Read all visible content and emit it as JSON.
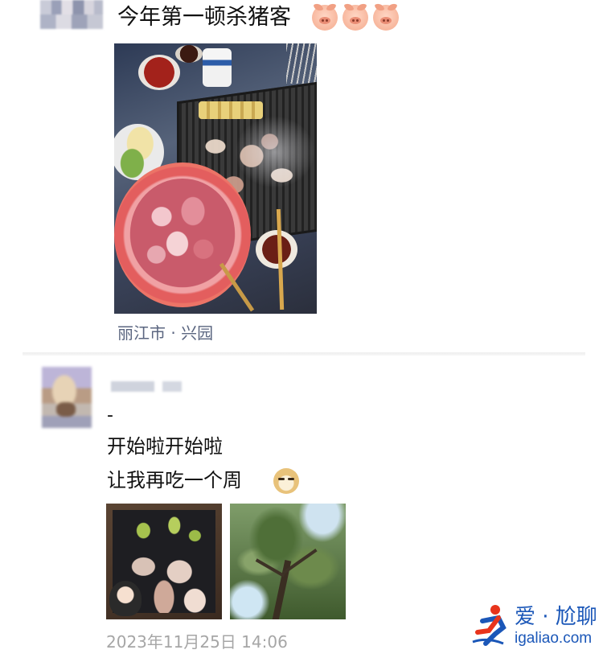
{
  "post1": {
    "text": "今年第一顿杀猪客",
    "emojis": [
      "pig-face-icon",
      "pig-face-icon",
      "pig-face-icon"
    ],
    "location": "丽江市 · 兴园"
  },
  "post2": {
    "dash": "-",
    "line1": "开始啦开始啦",
    "line2": "让我再吃一个周",
    "emoji": "doge-icon",
    "timestamp": "2023年11月25日 14:06"
  },
  "watermark": {
    "title": "爱 · 尬聊",
    "url": "igaliao.com"
  },
  "colors": {
    "location": "#5b6680",
    "timestamp": "#a6a6a6",
    "watermark": "#1b57b8"
  }
}
